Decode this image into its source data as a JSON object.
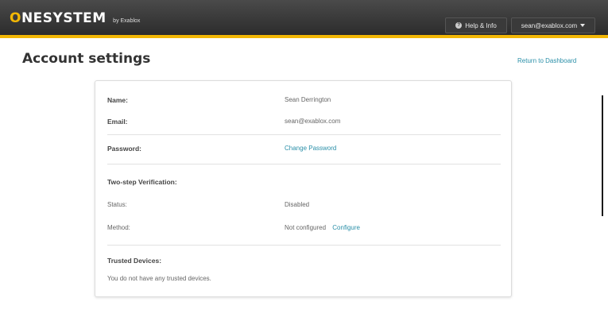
{
  "header": {
    "logo_accent": "O",
    "logo_main": "NESYSTEM",
    "logo_by": "by Exablox",
    "help_label": "Help & Info",
    "user_label": "sean@exablox.com",
    "accent_color": "#f2b705"
  },
  "page": {
    "title": "Account settings",
    "return_link": "Return to Dashboard"
  },
  "account": {
    "name_label": "Name:",
    "name_value": "Sean Derrington",
    "email_label": "Email:",
    "email_value": "sean@exablox.com",
    "password_label": "Password:",
    "password_link": "Change Password",
    "two_step_title": "Two-step Verification:",
    "status_label": "Status:",
    "status_value": "Disabled",
    "method_label": "Method:",
    "method_value": "Not configured",
    "method_link": "Configure",
    "trusted_title": "Trusted Devices:",
    "trusted_note": "You do not have any trusted devices."
  },
  "icons": {
    "help": "question-circle-icon",
    "dropdown": "chevron-down-icon"
  },
  "colors": {
    "link": "#2a8fa8",
    "topbar": "#333333"
  }
}
